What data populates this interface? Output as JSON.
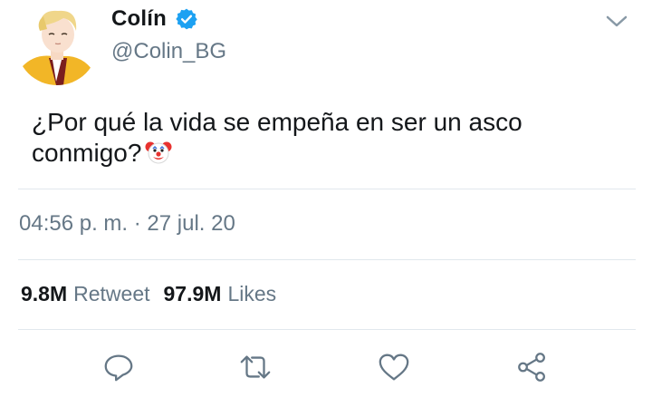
{
  "author": {
    "display_name": "Colín",
    "handle": "@Colin_BG",
    "verified_icon": "verified-badge-icon",
    "avatar": "avatar"
  },
  "tweet": {
    "text": "¿Por qué la vida se empeña en ser un asco conmigo?",
    "emoji": "clown-face-icon",
    "timestamp": "04:56 p. m. · 27 jul. 20"
  },
  "stats": {
    "retweets_count": "9.8M",
    "retweets_label": "Retweet",
    "likes_count": "97.9M",
    "likes_label": "Likes"
  },
  "actions": [
    "reply-icon",
    "retweet-icon",
    "like-icon",
    "share-icon"
  ],
  "colors": {
    "text": "#14171a",
    "secondary": "#657786",
    "divider": "#e1e8ed",
    "verified": "#1da1f2"
  }
}
